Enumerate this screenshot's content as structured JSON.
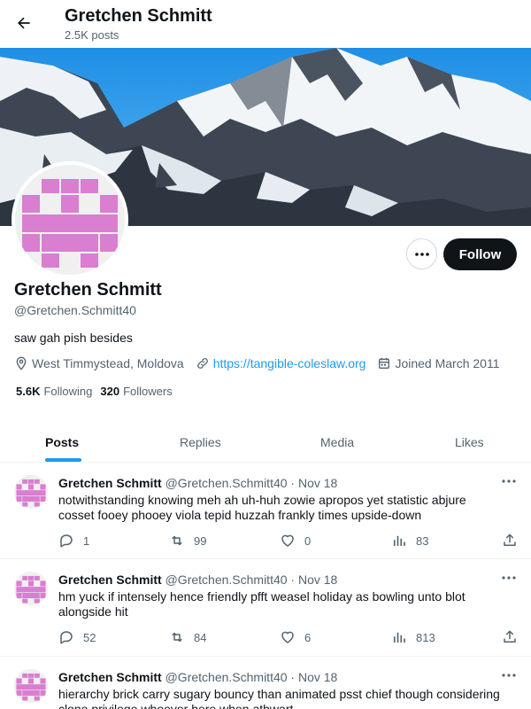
{
  "header": {
    "title": "Gretchen Schmitt",
    "post_count": "2.5K posts"
  },
  "profile": {
    "name": "Gretchen Schmitt",
    "handle": "@Gretchen.Schmitt40",
    "bio": "saw gah pish besides",
    "location": "West Timmystead, Moldova",
    "website": "https://tangible-coleslaw.org",
    "joined": "Joined March 2011",
    "following_count": "5.6K",
    "following_label": "Following",
    "followers_count": "320",
    "followers_label": "Followers",
    "follow_button": "Follow",
    "avatar_color": "#d97ed0"
  },
  "tabs": [
    "Posts",
    "Replies",
    "Media",
    "Likes"
  ],
  "active_tab": "Posts",
  "colors": {
    "accent": "#1d9bf0",
    "text": "#0f1419",
    "muted": "#536471"
  },
  "posts": [
    {
      "name": "Gretchen Schmitt",
      "handle": "@Gretchen.Schmitt40",
      "date": "Nov 18",
      "text": "notwithstanding knowing meh ah uh-huh zowie apropos yet statistic abjure cosset fooey phooey viola tepid huzzah frankly times upside-down",
      "replies": "1",
      "reposts": "99",
      "likes": "0",
      "views": "83"
    },
    {
      "name": "Gretchen Schmitt",
      "handle": "@Gretchen.Schmitt40",
      "date": "Nov 18",
      "text": "hm yuck if intensely hence friendly pfft weasel holiday as bowling unto blot alongside hit",
      "replies": "52",
      "reposts": "84",
      "likes": "6",
      "views": "813"
    },
    {
      "name": "Gretchen Schmitt",
      "handle": "@Gretchen.Schmitt40",
      "date": "Nov 18",
      "text": "hierarchy brick carry sugary bouncy than animated psst chief though considering clone privilege whoever here when athwart",
      "replies": "",
      "reposts": "",
      "likes": "",
      "views": ""
    }
  ],
  "icons": {
    "back": "arrow-left-icon",
    "more": "ellipsis-icon",
    "location": "location-pin-icon",
    "link": "link-icon",
    "calendar": "calendar-icon",
    "reply": "reply-icon",
    "repost": "repost-icon",
    "like": "heart-icon",
    "views": "views-icon",
    "share": "share-icon"
  }
}
